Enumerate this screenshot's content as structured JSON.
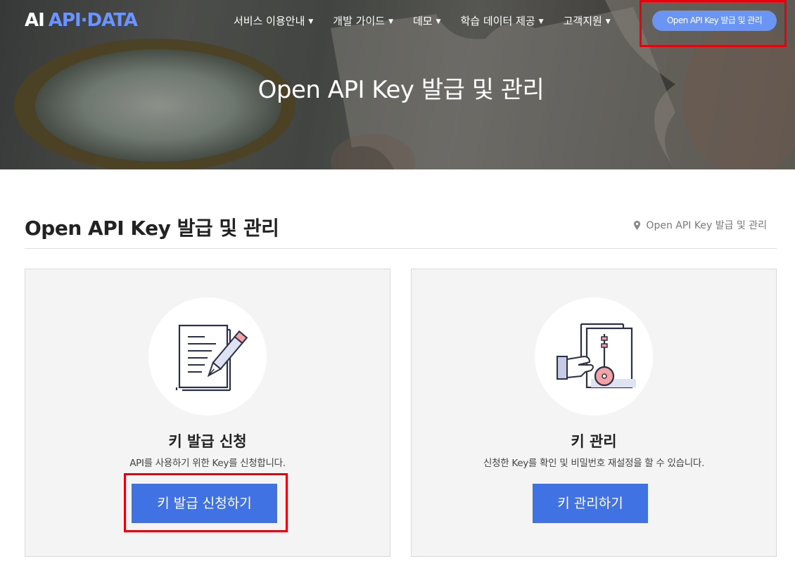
{
  "brand": {
    "part1": "AI",
    "part2": "API·DATA",
    "accent_color": "#6c94ff"
  },
  "nav": {
    "items": [
      {
        "label": "서비스 이용안내"
      },
      {
        "label": "개발 가이드"
      },
      {
        "label": "데모"
      },
      {
        "label": "학습 데이터 제공"
      },
      {
        "label": "고객지원"
      }
    ],
    "cta_label": "Open API Key 발급 및 관리",
    "cta_color": "#6a95f5"
  },
  "hero": {
    "title": "Open API Key 발급 및 관리"
  },
  "page": {
    "title": "Open API Key 발급 및 관리",
    "breadcrumb": "Open API Key 발급 및 관리"
  },
  "cards": [
    {
      "icon": "document-pen-icon",
      "title": "키 발급 신청",
      "description": "API를 사용하기 위한 Key를 신청합니다.",
      "button_label": "키 발급 신청하기"
    },
    {
      "icon": "key-card-icon",
      "title": "키 관리",
      "description": "신청한 Key를 확인 및 비밀번호 재설정을 할 수 있습니다.",
      "button_label": "키 관리하기"
    }
  ],
  "colors": {
    "button": "#4172e4",
    "highlight": "#e8000b",
    "card_bg": "#f4f4f4"
  }
}
